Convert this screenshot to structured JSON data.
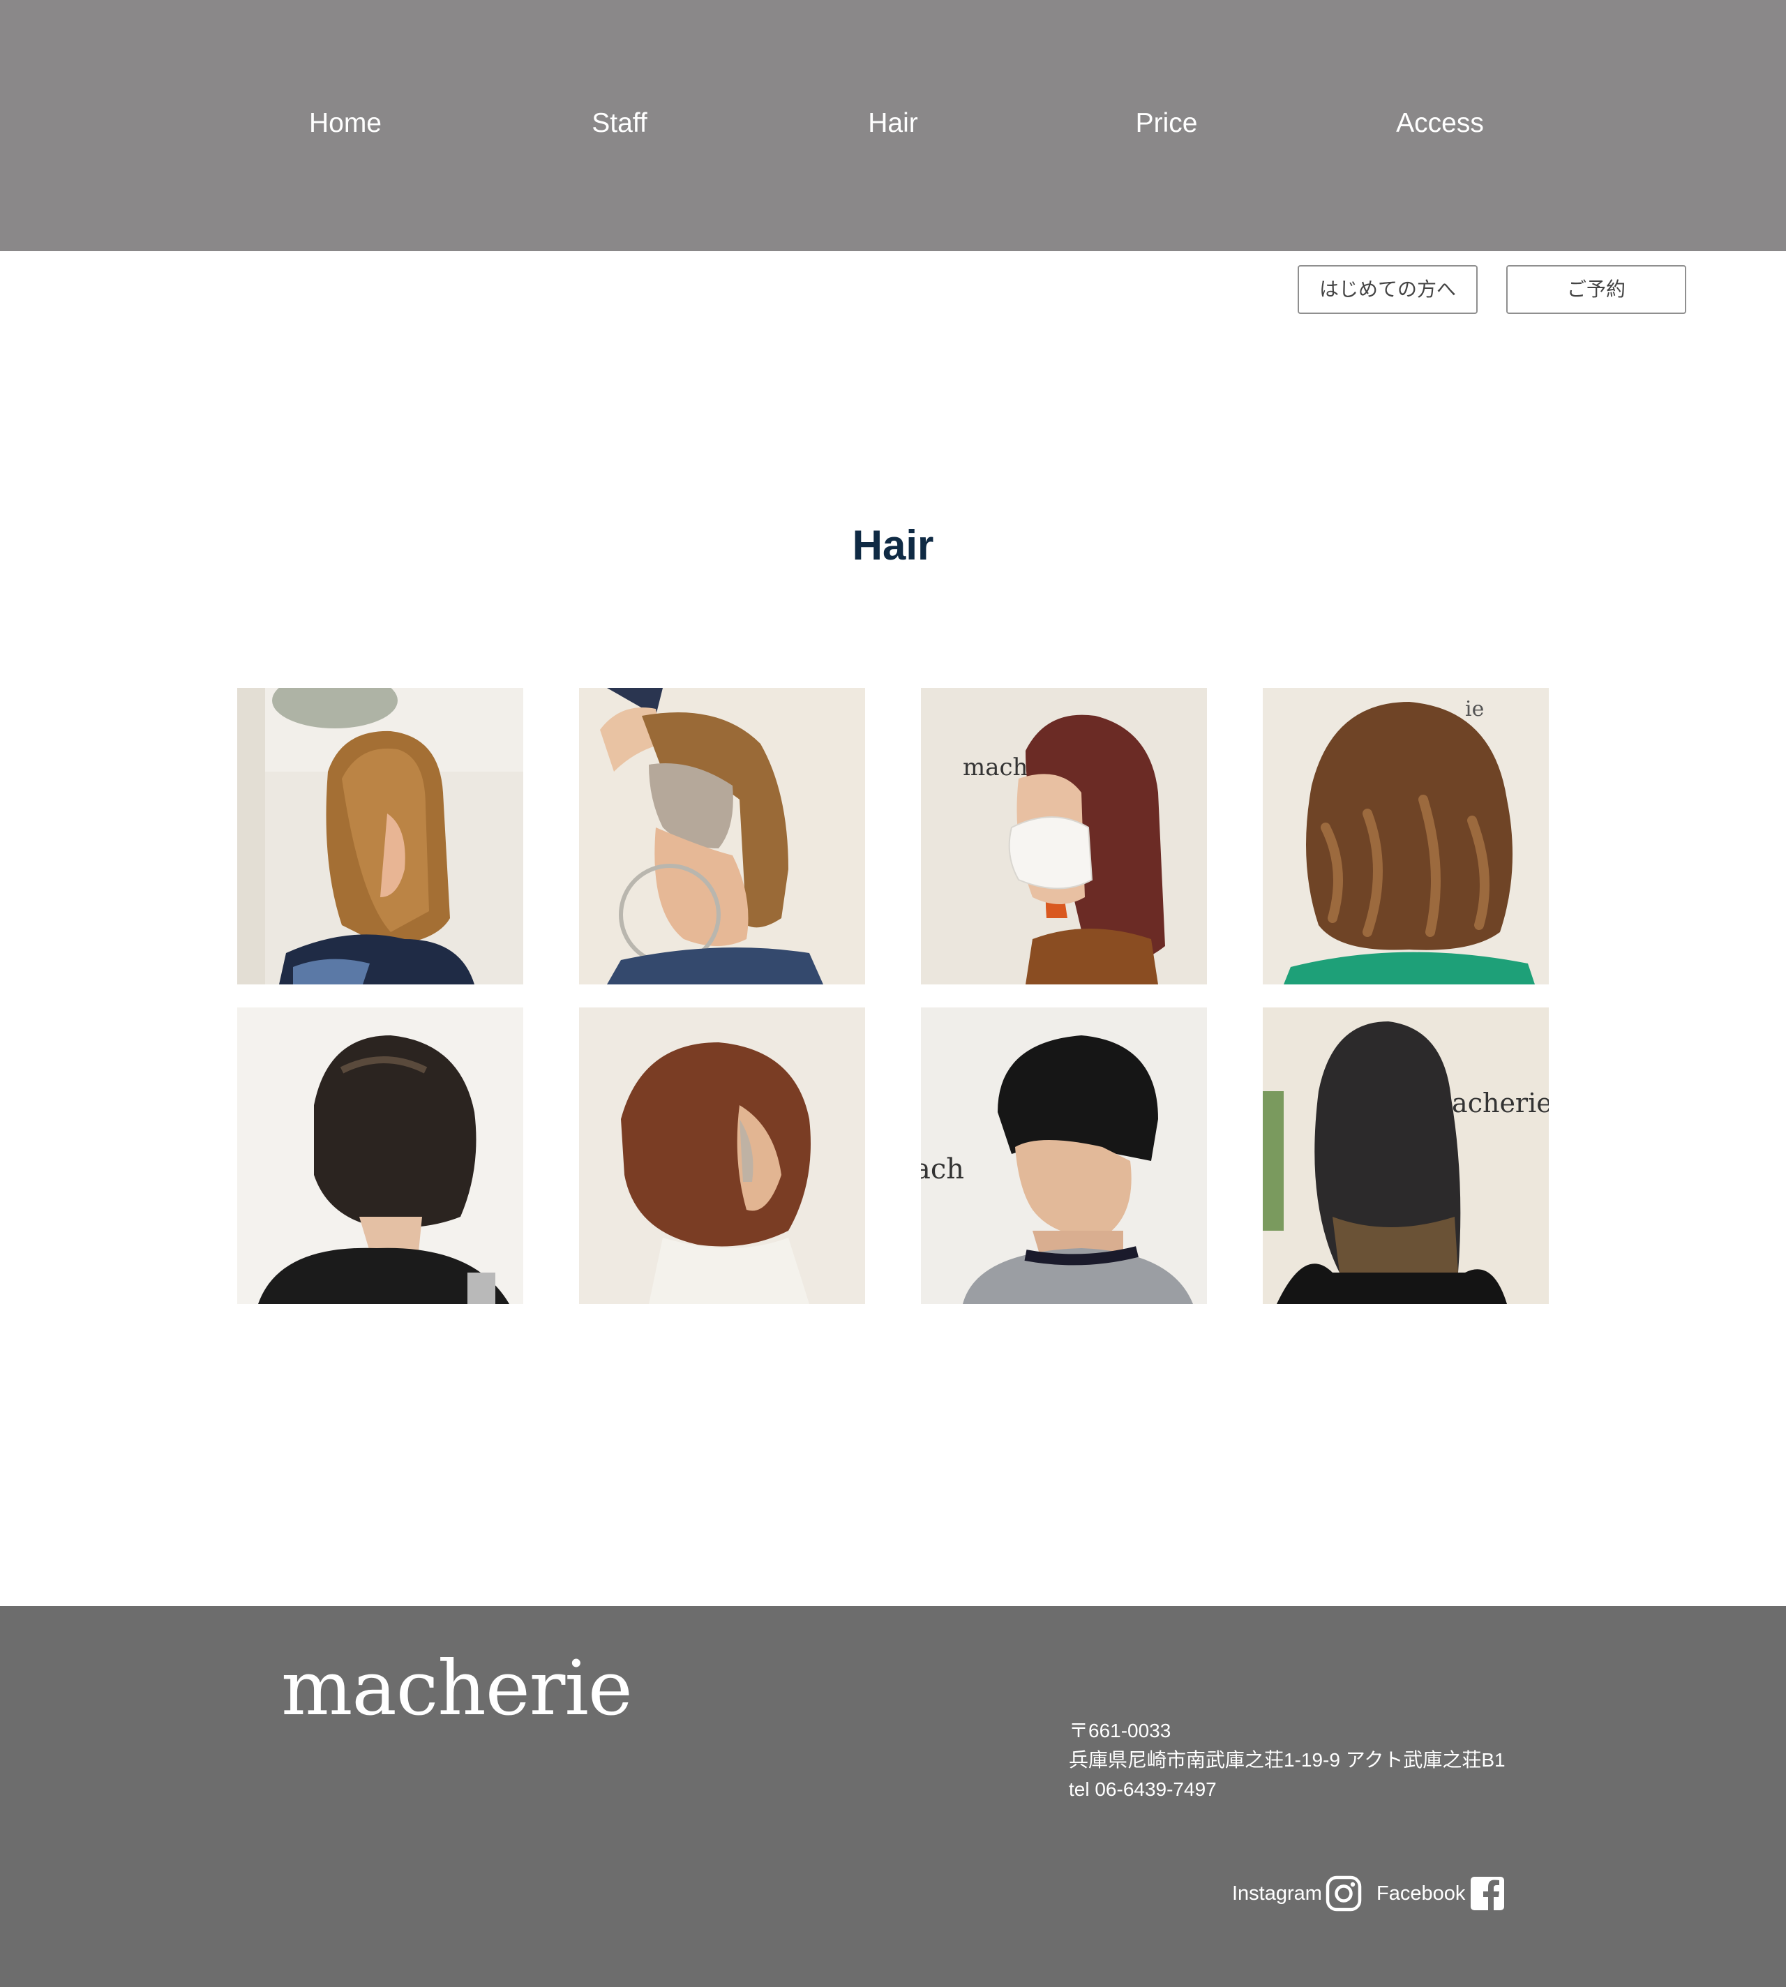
{
  "nav": {
    "items": [
      "Home",
      "Staff",
      "Hair",
      "Price",
      "Access"
    ]
  },
  "actions": {
    "first_time_label": "はじめての方へ",
    "reserve_label": "ご予約"
  },
  "main": {
    "title": "Hair",
    "photo_watermark": "macherie"
  },
  "footer": {
    "logo": "macherie",
    "postal": "〒661-0033",
    "address": "兵庫県尼崎市南武庫之荘1-19-9 アクト武庫之荘B1",
    "tel": "tel 06-6439-7497",
    "instagram_label": "Instagram",
    "facebook_label": "Facebook",
    "instagram_icon": "instagram-icon",
    "facebook_icon": "facebook-icon"
  },
  "colors": {
    "nav_bg": "#8a8889",
    "footer_bg": "#6d6d6d",
    "title": "#0f2a44"
  }
}
